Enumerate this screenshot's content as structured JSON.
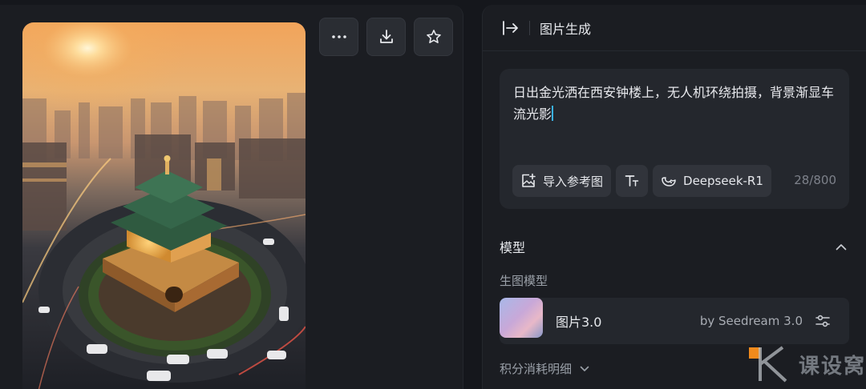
{
  "canvas": {
    "image_alt": "Xi'an Bell Tower at sunrise",
    "actions": [
      {
        "name": "more-button",
        "icon": "ellipsis-icon"
      },
      {
        "name": "download-button",
        "icon": "download-icon"
      },
      {
        "name": "favorite-button",
        "icon": "star-icon"
      }
    ]
  },
  "panel": {
    "title": "图片生成",
    "prompt": "日出金光洒在西安钟楼上，无人机环绕拍摄，背景渐显车流光影",
    "tools": {
      "import_ref": "导入参考图",
      "model_switch": "Deepseek-R1"
    },
    "counter": "28/800",
    "model_section": {
      "title": "模型",
      "sub_label": "生图模型",
      "model_name": "图片3.0",
      "model_by": "by Seedream 3.0",
      "points_link": "积分消耗明细"
    }
  },
  "watermark": {
    "text": "课设窝"
  },
  "colors": {
    "background": "#15171c",
    "panel": "#1b1d22",
    "card": "#24272d",
    "caret": "#3ab1e4",
    "watermark_accent": "#f08a1c"
  }
}
